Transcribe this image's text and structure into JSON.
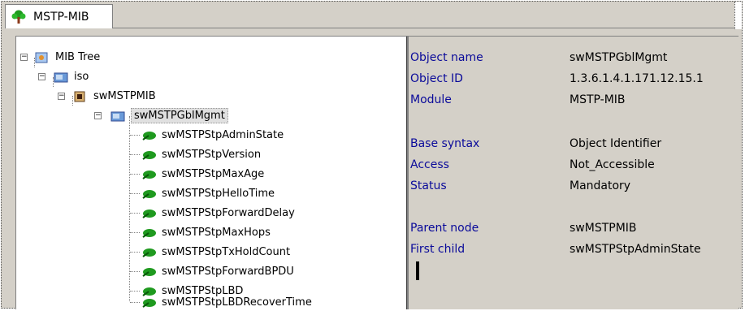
{
  "tab": {
    "label": "MSTP-MIB"
  },
  "tree": {
    "root": "MIB Tree",
    "iso": "iso",
    "module": "swMSTPMIB",
    "selected": "swMSTPGblMgmt",
    "children": [
      "swMSTPStpAdminState",
      "swMSTPStpVersion",
      "swMSTPStpMaxAge",
      "swMSTPStpHelloTime",
      "swMSTPStpForwardDelay",
      "swMSTPStpMaxHops",
      "swMSTPStpTxHoldCount",
      "swMSTPStpForwardBPDU",
      "swMSTPStpLBD",
      "swMSTPStpLBDRecoverTime"
    ]
  },
  "details": {
    "object_name": {
      "key": "Object name",
      "value": "swMSTPGblMgmt"
    },
    "object_id": {
      "key": "Object ID",
      "value": "1.3.6.1.4.1.171.12.15.1"
    },
    "module": {
      "key": "Module",
      "value": "MSTP-MIB"
    },
    "base_syntax": {
      "key": "Base syntax",
      "value": "Object Identifier"
    },
    "access": {
      "key": "Access",
      "value": "Not_Accessible"
    },
    "status": {
      "key": "Status",
      "value": "Mandatory"
    },
    "parent_node": {
      "key": "Parent node",
      "value": "swMSTPMIB"
    },
    "first_child": {
      "key": "First child",
      "value": "swMSTPStpAdminState"
    }
  },
  "colors": {
    "key_text": "#0a0a9a",
    "leaf_icon": "#1f9a1f",
    "panel_bg": "#d4d0c8"
  }
}
